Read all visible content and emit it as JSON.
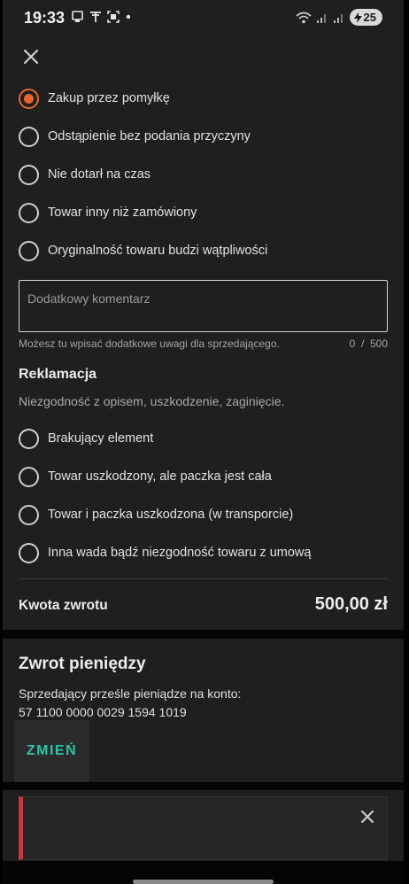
{
  "status_bar": {
    "time": "19:33",
    "left_icons": [
      "notification-icon",
      "antenna-icon",
      "screenshot-icon",
      "dot-icon"
    ],
    "right_icons": [
      "wifi-icon",
      "signal-icon",
      "signal-icon"
    ],
    "battery": "25"
  },
  "return_reasons": [
    {
      "label": "Zakup przez pomyłkę",
      "selected": true
    },
    {
      "label": "Odstąpienie bez podania przyczyny",
      "selected": false
    },
    {
      "label": "Nie dotarł na czas",
      "selected": false
    },
    {
      "label": "Towar inny niż zamówiony",
      "selected": false
    },
    {
      "label": "Oryginalność towaru budzi wątpliwości",
      "selected": false
    }
  ],
  "comment": {
    "placeholder": "Dodatkowy komentarz",
    "value": "",
    "helper": "Możesz tu wpisać dodatkowe uwagi dla sprzedającego.",
    "counter": "0  /  500"
  },
  "complaint": {
    "title": "Reklamacja",
    "subtitle": "Niezgodność z opisem, uszkodzenie, zaginięcie.",
    "reasons": [
      {
        "label": "Brakujący element",
        "selected": false
      },
      {
        "label": "Towar uszkodzony, ale paczka jest cała",
        "selected": false
      },
      {
        "label": "Towar i paczka uszkodzona (w transporcie)",
        "selected": false
      },
      {
        "label": "Inna wada bądź niezgodność towaru z umową",
        "selected": false
      }
    ]
  },
  "refund_amount": {
    "label": "Kwota zwrotu",
    "value": "500,00 zł"
  },
  "refund": {
    "title": "Zwrot pieniędzy",
    "text_line1": "Sprzedający prześle pieniądze na konto:",
    "account": "57 1100 0000 0029 1594 1019",
    "change_label": "ZMIEŃ"
  },
  "colors": {
    "accent": "#e8662c",
    "action": "#2ec4a7",
    "alert": "#c23b3b",
    "background": "#1f1f1f"
  }
}
